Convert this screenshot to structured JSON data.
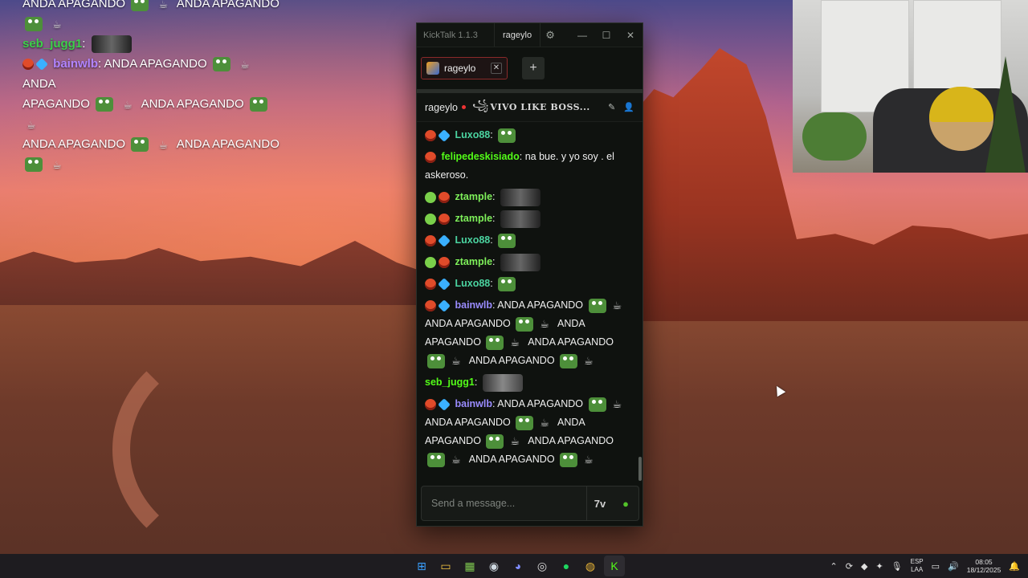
{
  "overlay_chat": {
    "lines": [
      {
        "parts": [
          "ANDA APAGANDO",
          "ANDA APAGANDO"
        ]
      },
      {
        "user": "seb_jugg1"
      },
      {
        "user": "bainwlb",
        "text": [
          "ANDA APAGANDO",
          "ANDA",
          "APAGANDO",
          "ANDA APAGANDO",
          "ANDA APAGANDO",
          "ANDA APAGANDO"
        ]
      }
    ],
    "line1_a": "ANDA APAGANDO",
    "line1_b": "ANDA APAGANDO",
    "seb_user": "seb_jugg1",
    "bain_user": "bainwlb",
    "anda_apagando": "ANDA APAGANDO",
    "anda": "ANDA",
    "apagando": "APAGANDO",
    "colon": ":"
  },
  "window": {
    "app_name": "KickTalk 1.1.3",
    "title_tab": "rageylo",
    "gear": "⚙",
    "minimize": "—",
    "maximize": "☐",
    "close": "✕"
  },
  "tabs": {
    "items": [
      {
        "label": "rageylo",
        "close": "✕"
      }
    ],
    "add": "+"
  },
  "channel": {
    "name": "rageylo",
    "stream_glyph": "꧁",
    "stream_title": "VIVO LIKE BOSS...",
    "pin_icon": "✎",
    "user_icon": "👤"
  },
  "messages": [
    {
      "user": "Luxo88",
      "text": ""
    },
    {
      "user": "felipedeskisiado",
      "text": "na bue. y yo soy . el askeroso."
    },
    {
      "user": "ztample",
      "text": ""
    },
    {
      "user": "ztample",
      "text": ""
    },
    {
      "user": "Luxo88",
      "text": ""
    },
    {
      "user": "ztample",
      "text": ""
    },
    {
      "user": "Luxo88",
      "text": ""
    },
    {
      "user": "bainwlb",
      "text": "ANDA APAGANDO"
    },
    {
      "user": "seb_jugg1",
      "text": ""
    },
    {
      "user": "bainwlb",
      "text": "ANDA APAGANDO"
    }
  ],
  "phrases": {
    "anda_apagando": "ANDA APAGANDO",
    "anda": "ANDA",
    "apagando": "APAGANDO"
  },
  "input": {
    "placeholder": "Send a message...",
    "btn_7tv": "7v",
    "btn_emote": "●"
  },
  "taskbar": {
    "lang_top": "ESP",
    "lang_bottom": "LAA",
    "time": "08:05",
    "date": "18/12/2025"
  },
  "colors": {
    "kick_green": "#53fc18",
    "tab_border": "#8a2a2a",
    "window_bg": "#0f120f"
  }
}
